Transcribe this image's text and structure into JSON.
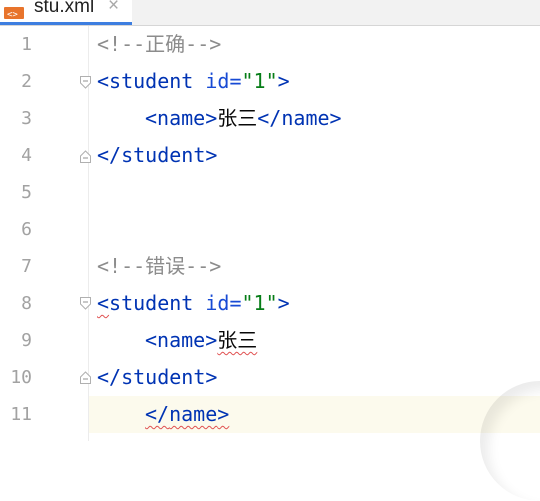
{
  "tab": {
    "title": "stu.xml",
    "close": "×",
    "icon": "xml-file-icon"
  },
  "gutter": {
    "line_numbers": [
      "1",
      "2",
      "3",
      "4",
      "5",
      "6",
      "7",
      "8",
      "9",
      "10",
      "11"
    ]
  },
  "code": {
    "l1": {
      "open": "<!--",
      "text": "正确",
      "close": "-->"
    },
    "l2": {
      "lt": "<",
      "tag": "student",
      "attr": " id=",
      "val": "\"1\"",
      "gt": ">"
    },
    "l3": {
      "lt": "<",
      "tag": "name",
      "gt": ">",
      "text": "张三",
      "endlt": "</",
      "endtag": "name",
      "endgt": ">"
    },
    "l4": {
      "lt": "</",
      "tag": "student",
      "gt": ">"
    },
    "l7": {
      "open": "<!--",
      "text": "错误",
      "close": "-->"
    },
    "l8": {
      "lt": "<",
      "tag": "student",
      "attr": " id=",
      "val": "\"1\"",
      "gt": ">"
    },
    "l9": {
      "lt": "<",
      "tag": "name",
      "gt": ">",
      "text": "张三"
    },
    "l10": {
      "lt": "</",
      "tag": "student",
      "gt": ">"
    },
    "l11": {
      "lt": "</",
      "tag": "name",
      "gt": ">"
    }
  },
  "colors": {
    "tag": "#0033b3",
    "attr": "#174ad4",
    "value": "#067d17",
    "comment": "#8c8c8c",
    "error": "#e05050",
    "current_line": "#fcfaed"
  }
}
